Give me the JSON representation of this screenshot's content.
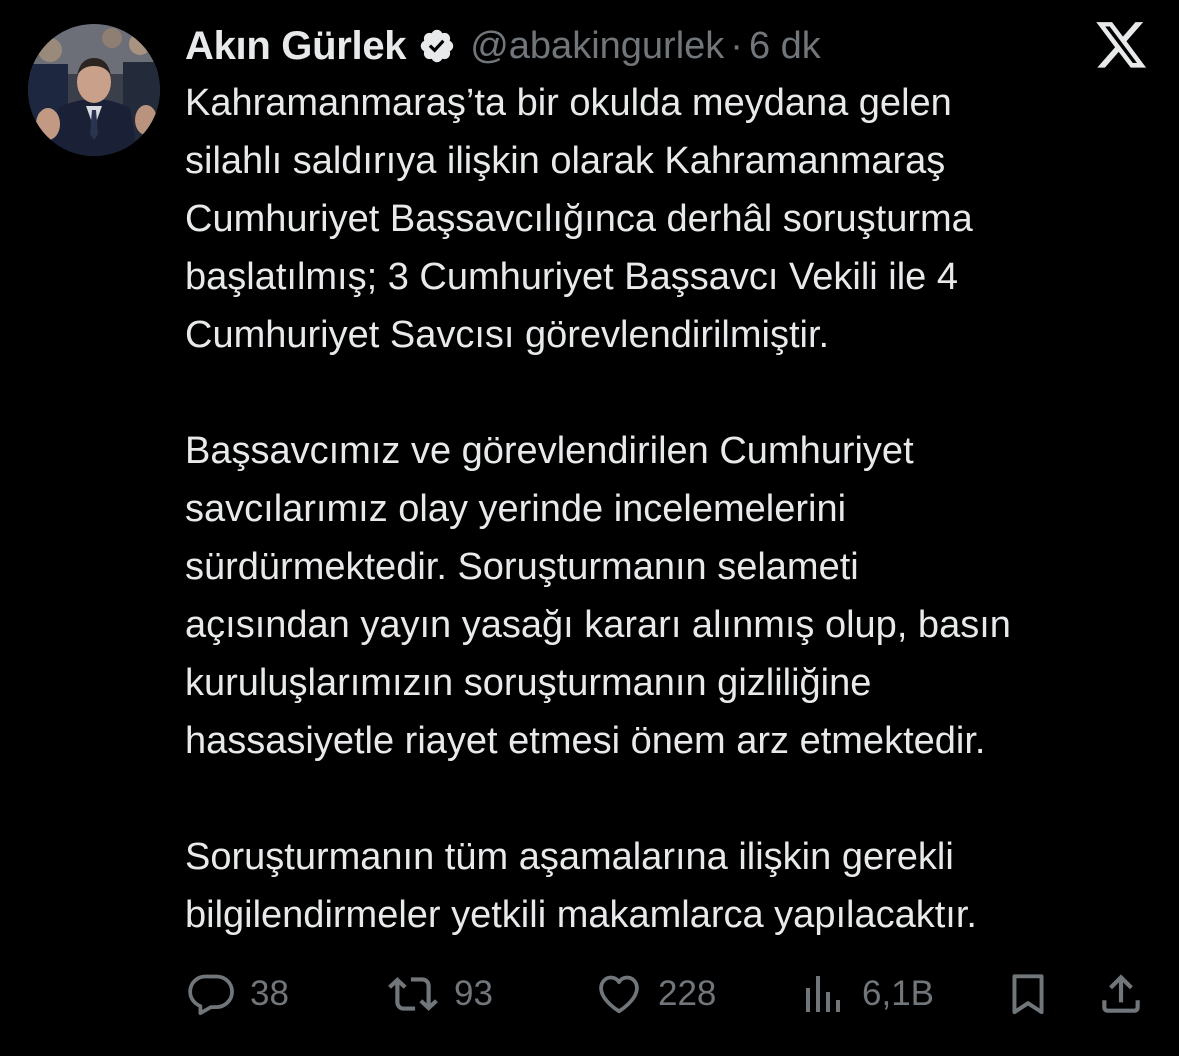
{
  "tweet": {
    "author": {
      "display_name": "Akın Gürlek",
      "handle": "@abakingurlek",
      "verified": true,
      "avatar_icon": "profile-photo"
    },
    "separator": "·",
    "timestamp": "6 dk",
    "text": "Kahramanmaraş’ta bir okulda meydana gelen\nsilahlı saldırıya ilişkin olarak Kahramanmaraş\nCumhuriyet Başsavcılığınca derhâl soruşturma\nbaşlatılmış; 3 Cumhuriyet Başsavcı Vekili ile 4\nCumhuriyet Savcısı görevlendirilmiştir.\n\nBaşsavcımız ve görevlendirilen Cumhuriyet\nsavcılarımız olay yerinde incelemelerini\nsürdürmektedir. Soruşturmanın selameti\naçısından yayın yasağı kararı alınmış olup, basın\nkuruluşlarımızın soruşturmanın gizliliğine\nhassasiyetle riayet etmesi önem arz etmektedir.\n\nSoruşturmanın tüm aşamalarına ilişkin gerekli\nbilgilendirmeler yetkili makamlarca yapılacaktır.",
    "actions": {
      "replies": "38",
      "reposts": "93",
      "likes": "228",
      "views": "6,1B"
    }
  },
  "icons": {
    "brand": "x-logo-icon",
    "verified": "verified-badge-icon",
    "reply": "reply-icon",
    "repost": "repost-icon",
    "like": "heart-icon",
    "views": "views-icon",
    "bookmark": "bookmark-icon",
    "share": "share-icon"
  },
  "colors": {
    "background": "#000000",
    "text": "#e7e9ea",
    "muted": "#71767b",
    "verified_badge": "#e7e9ea"
  }
}
